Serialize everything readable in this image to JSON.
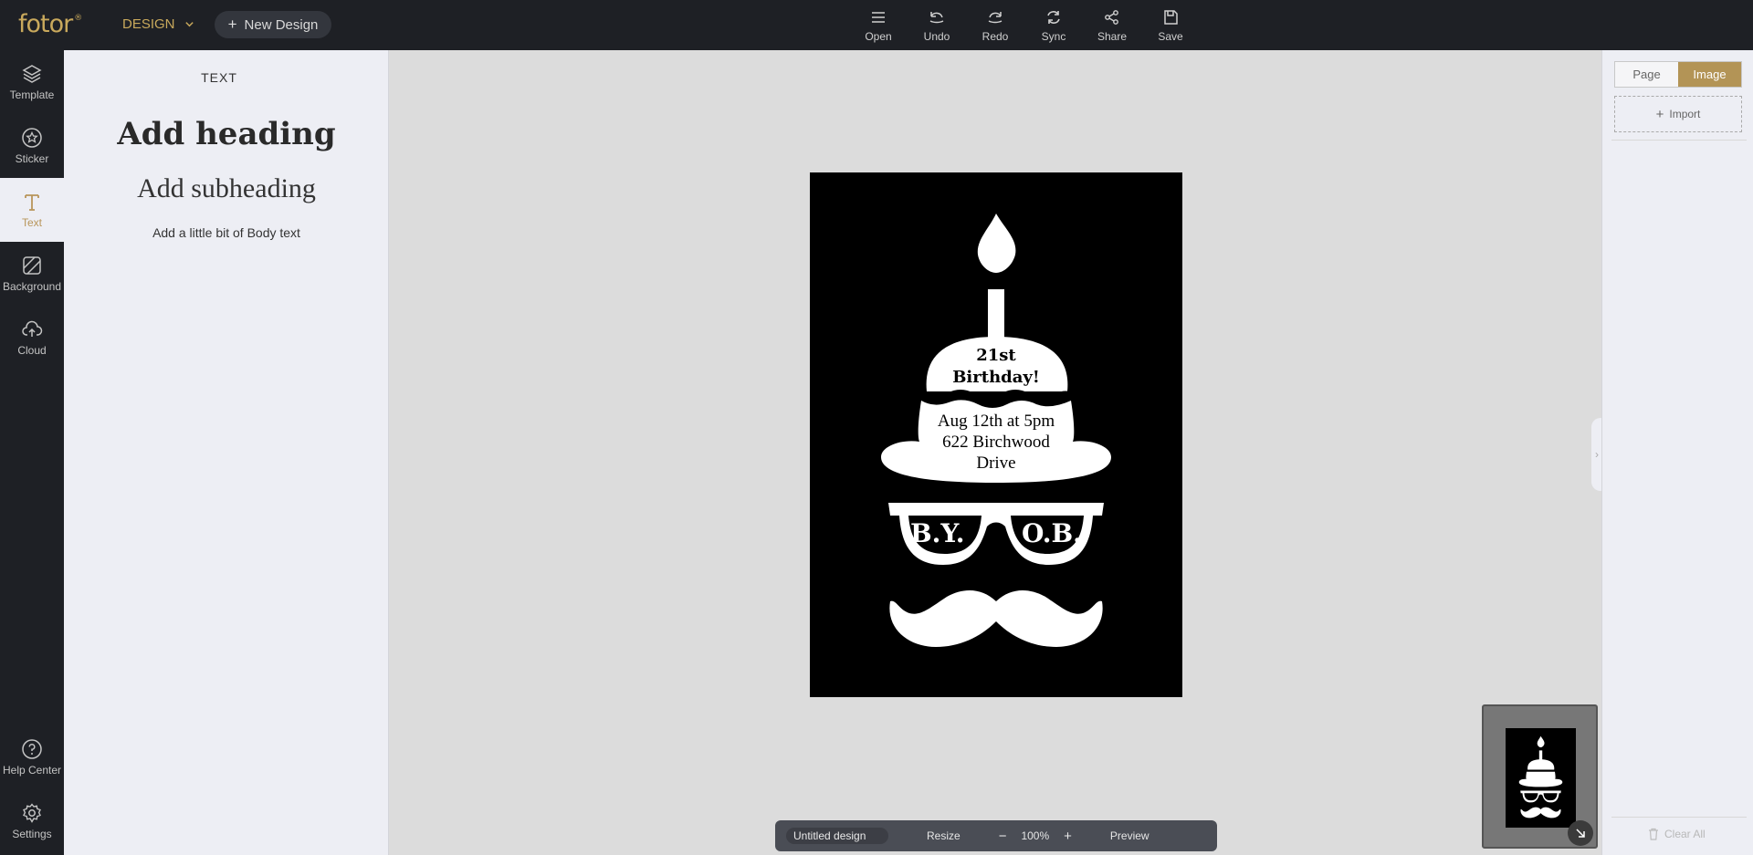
{
  "topbar": {
    "logo": "fotor",
    "logo_mark": "®",
    "design_menu": "DESIGN",
    "new_design": "New Design",
    "tools": [
      {
        "label": "Open",
        "icon": "menu-icon"
      },
      {
        "label": "Undo",
        "icon": "undo-icon"
      },
      {
        "label": "Redo",
        "icon": "redo-icon"
      },
      {
        "label": "Sync",
        "icon": "sync-icon"
      },
      {
        "label": "Share",
        "icon": "share-icon"
      },
      {
        "label": "Save",
        "icon": "save-icon"
      }
    ]
  },
  "leftnav": {
    "items": [
      {
        "label": "Template",
        "icon": "layers-icon"
      },
      {
        "label": "Sticker",
        "icon": "star-icon"
      },
      {
        "label": "Text",
        "icon": "text-icon",
        "active": true
      },
      {
        "label": "Background",
        "icon": "background-icon"
      },
      {
        "label": "Cloud",
        "icon": "cloud-upload-icon"
      },
      {
        "label": "Help Center",
        "icon": "help-icon"
      },
      {
        "label": "Settings",
        "icon": "gear-icon"
      }
    ]
  },
  "textpanel": {
    "title": "TEXT",
    "heading": "Add heading",
    "subheading": "Add subheading",
    "body": "Add a little bit of Body text"
  },
  "card": {
    "line1": "21st",
    "line2": "Birthday!",
    "details": [
      "Aug 12th at 5pm",
      "622 Birchwood",
      "Drive"
    ],
    "lens_left": "B.Y.",
    "lens_right": "O.B."
  },
  "rightpanel": {
    "tabs": [
      {
        "label": "Page",
        "active": false
      },
      {
        "label": "Image",
        "active": true
      }
    ],
    "import": "Import",
    "clear_all": "Clear All"
  },
  "bottombar": {
    "doc_name": "Untitled design",
    "resize": "Resize",
    "zoom_minus": "−",
    "zoom": "100%",
    "zoom_plus": "+",
    "preview": "Preview"
  },
  "colors": {
    "accent": "#b8955a",
    "dark": "#1e2025",
    "panel": "#edeef4",
    "workspace": "#dcdcdc"
  }
}
